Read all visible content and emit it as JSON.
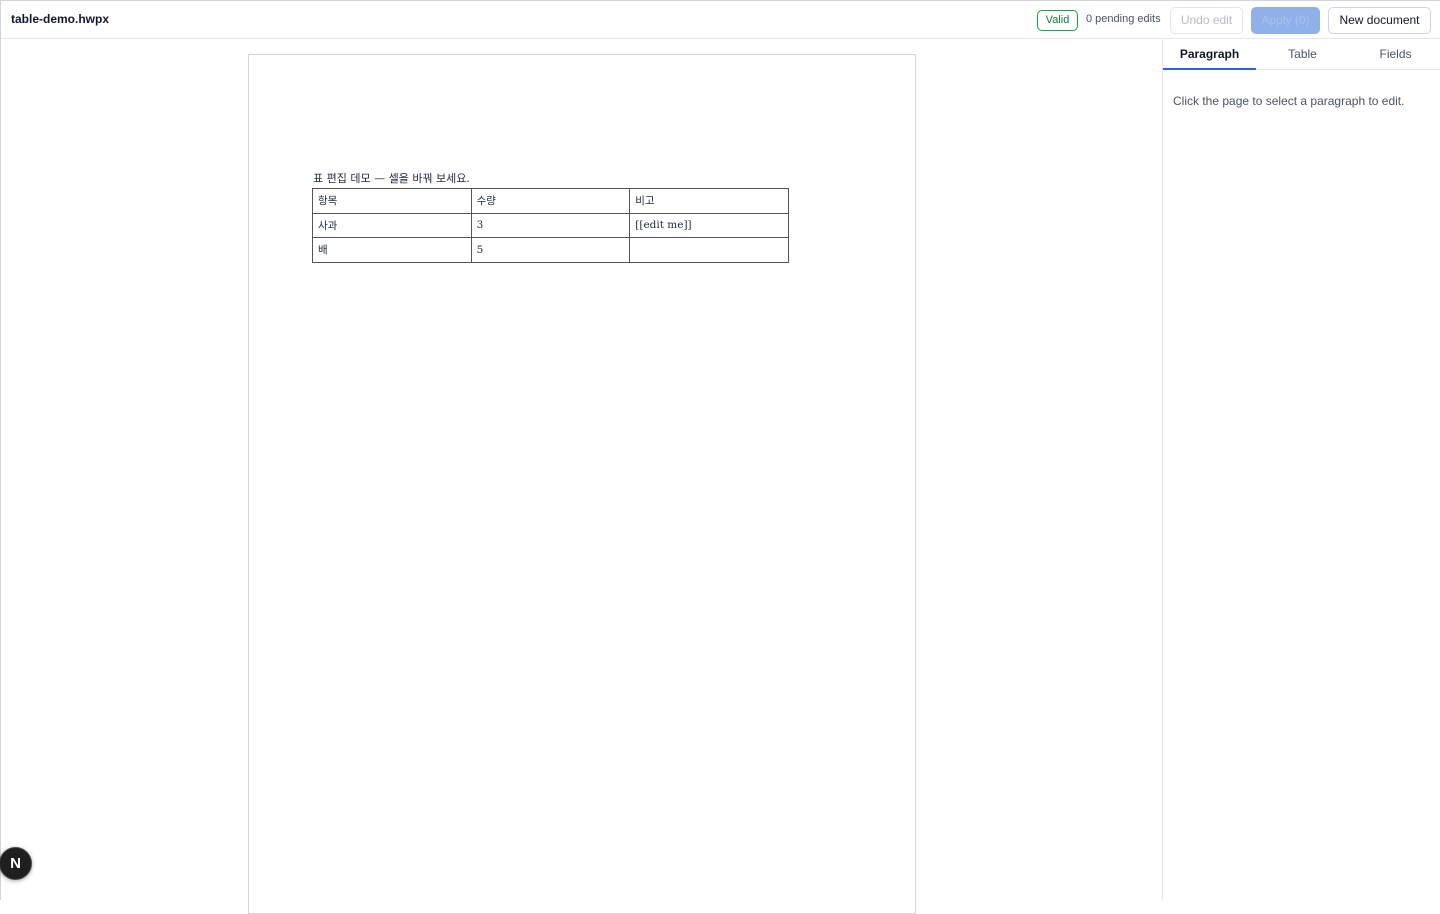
{
  "header": {
    "title": "table-demo.hwpx",
    "status_badge": "Valid",
    "pending_edits": "0 pending edits",
    "undo_label": "Undo edit",
    "apply_label": "Apply (0)",
    "new_document_label": "New document"
  },
  "document": {
    "heading": "표 편집 데모 — 셀을 바꿔 보세요.",
    "table": {
      "rows": [
        [
          "항목",
          "수량",
          "비고"
        ],
        [
          "사과",
          "3",
          "[[edit me]]"
        ],
        [
          "배",
          "5",
          ""
        ]
      ]
    }
  },
  "panel": {
    "tabs": [
      {
        "label": "Paragraph",
        "active": true
      },
      {
        "label": "Table",
        "active": false
      },
      {
        "label": "Fields",
        "active": false
      }
    ],
    "hint": "Click the page to select a paragraph to edit."
  },
  "fab": {
    "label": "N"
  },
  "colors": {
    "accent": "#2563eb",
    "valid": "#16a34a",
    "apply_disabled": "#8fb0e9"
  }
}
